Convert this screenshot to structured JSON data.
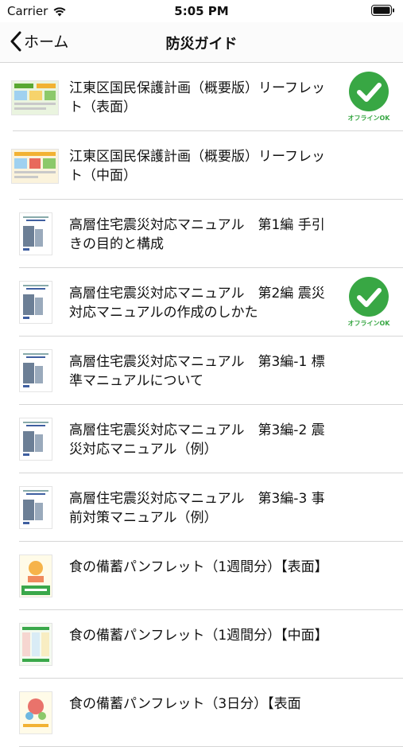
{
  "status": {
    "carrier": "Carrier",
    "time": "5:05 PM"
  },
  "nav": {
    "back_label": "ホーム",
    "title": "防災ガイド"
  },
  "items": [
    {
      "title": "江東区国民保護計画（概要版）リーフレット（表面）",
      "offline": "オフラインOK",
      "thumb": "leaflet-icon"
    },
    {
      "title": "江東区国民保護計画（概要版）リーフレット（中面）",
      "thumb": "leaflet-icon"
    },
    {
      "title": "高層住宅震災対応マニュアル　第1編 手引きの目的と構成",
      "thumb": "manual-cover-icon"
    },
    {
      "title": "高層住宅震災対応マニュアル　第2編 震災対応マニュアルの作成のしかた",
      "offline": "オフラインOK",
      "thumb": "manual-cover-icon"
    },
    {
      "title": "高層住宅震災対応マニュアル　第3編-1 標準マニュアルについて",
      "thumb": "manual-cover-icon"
    },
    {
      "title": "高層住宅震災対応マニュアル　第3編-2 震災対応マニュアル（例）",
      "thumb": "manual-cover-icon"
    },
    {
      "title": "高層住宅震災対応マニュアル　第3編-3 事前対策マニュアル（例）",
      "thumb": "manual-cover-icon"
    },
    {
      "title": "食の備蓄パンフレット（1週間分）【表面】",
      "thumb": "pamphlet-cover-icon"
    },
    {
      "title": "食の備蓄パンフレット（1週間分）【中面】",
      "thumb": "pamphlet-inner-icon"
    },
    {
      "title": "食の備蓄パンフレット（3日分）【表面",
      "thumb": "pamphlet-cover-icon"
    }
  ],
  "colors": {
    "offline_green": "#38a744"
  }
}
